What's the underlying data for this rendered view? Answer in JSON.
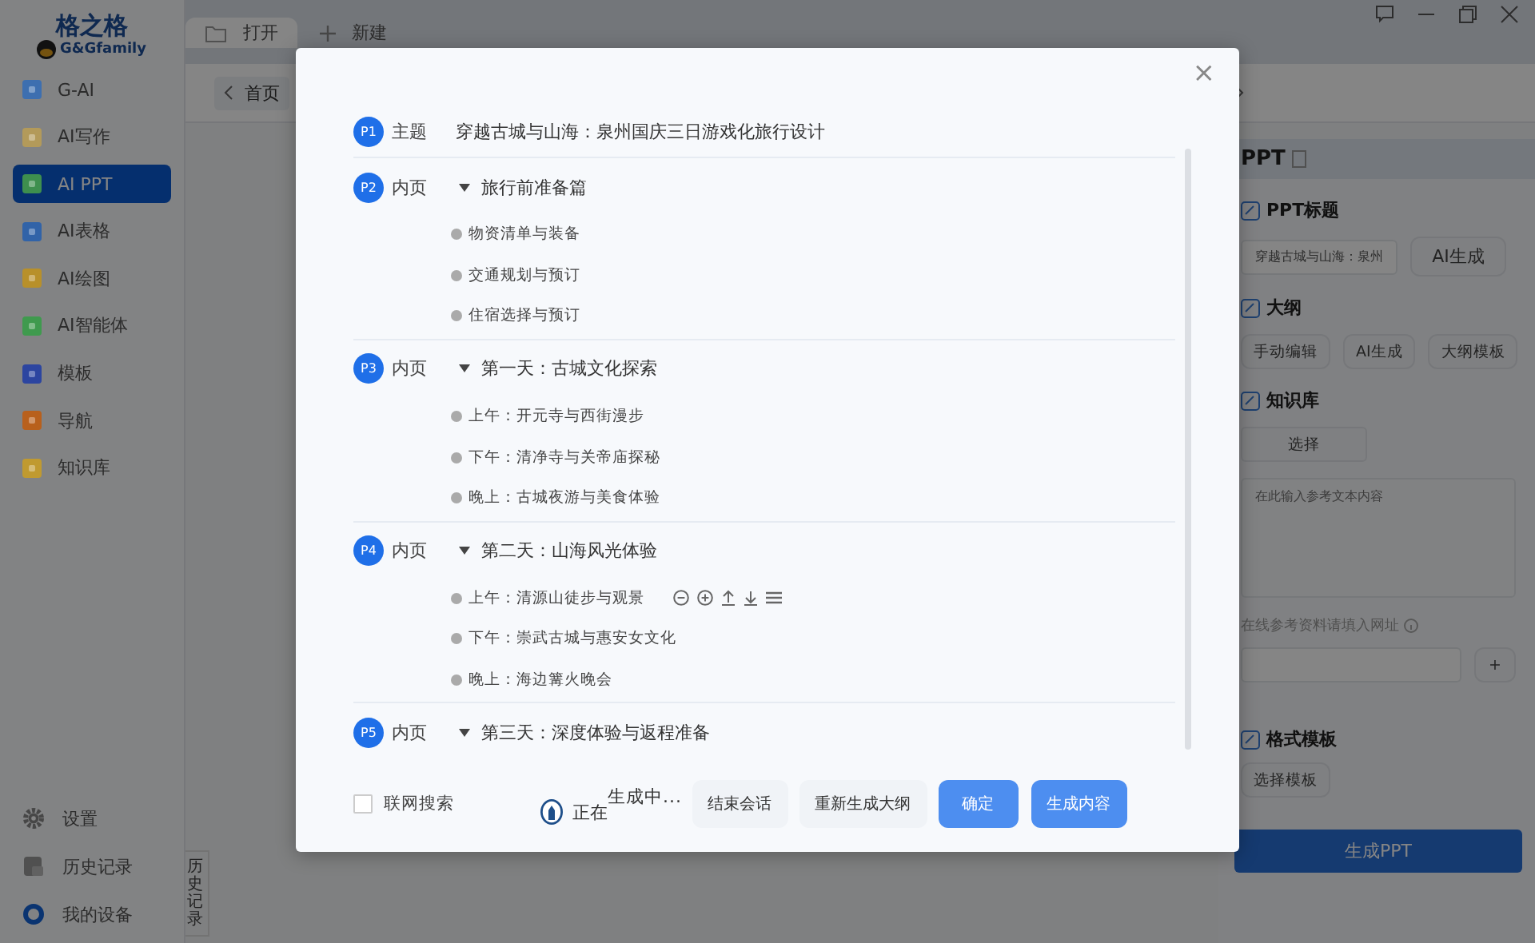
{
  "sidebar": {
    "logo": {
      "title": "格之格",
      "subtitle": "G&Gfamily"
    },
    "items": [
      {
        "label": "G-AI",
        "color": "#3d6fb0",
        "selected": false
      },
      {
        "label": "AI写作",
        "color": "#b39a5a",
        "selected": false
      },
      {
        "label": "AI PPT",
        "color": "#3e8f4e",
        "selected": true
      },
      {
        "label": "AI表格",
        "color": "#3163a8",
        "selected": false
      },
      {
        "label": "AI绘图",
        "color": "#b8902a",
        "selected": false
      },
      {
        "label": "AI智能体",
        "color": "#3f9a4e",
        "selected": false
      },
      {
        "label": "模板",
        "color": "#2c45a0",
        "selected": false
      },
      {
        "label": "导航",
        "color": "#b8601c",
        "selected": false
      },
      {
        "label": "知识库",
        "color": "#c09a30",
        "selected": false
      }
    ],
    "bottom": [
      {
        "label": "设置",
        "kind": "gear"
      },
      {
        "label": "历史记录",
        "kind": "history"
      },
      {
        "label": "我的设备",
        "kind": "device"
      }
    ]
  },
  "history_tab": "历史记录",
  "tabs": [
    {
      "label": "打开",
      "kind": "folder",
      "selected": true
    },
    {
      "label": "新建",
      "kind": "plus",
      "selected": false
    }
  ],
  "breadcrumb": "首页",
  "right_panel": {
    "title": "PPT",
    "ppt_title": {
      "label": "PPT标题",
      "value": "穿越古城与山海：泉州",
      "button": "AI生成"
    },
    "outline": {
      "label": "大纲",
      "buttons": [
        "手动编辑",
        "AI生成",
        "大纲模板"
      ]
    },
    "knowledge": {
      "label": "知识库",
      "button": "选择",
      "placeholder": "在此输入参考文本内容",
      "url_label": "在线参考资料请填入网址",
      "add": "+"
    },
    "format": {
      "label": "格式模板",
      "button": "选择模板"
    },
    "generate": "生成PPT"
  },
  "dialog": {
    "close": "×",
    "pages": [
      {
        "badge": "P1",
        "type": "主题",
        "title": "穿越古城与山海：泉州国庆三日游戏化旅行设计",
        "kind": "cover"
      },
      {
        "badge": "P2",
        "type": "内页",
        "title": "旅行前准备篇",
        "kind": "section",
        "expanded": true,
        "children": [
          {
            "text": "物资清单与装备",
            "actions": false
          },
          {
            "text": "交通规划与预订",
            "actions": false
          },
          {
            "text": "住宿选择与预订",
            "actions": false
          }
        ]
      },
      {
        "badge": "P3",
        "type": "内页",
        "title": "第一天：古城文化探索",
        "kind": "section",
        "expanded": true,
        "children": [
          {
            "text": "上午：开元寺与西街漫步",
            "actions": false
          },
          {
            "text": "下午：清净寺与关帝庙探秘",
            "actions": false
          },
          {
            "text": "晚上：古城夜游与美食体验",
            "actions": false
          }
        ]
      },
      {
        "badge": "P4",
        "type": "内页",
        "title": "第二天：山海风光体验",
        "kind": "section",
        "expanded": true,
        "children": [
          {
            "text": "上午：清源山徒步与观景",
            "actions": true
          },
          {
            "text": "下午：崇武古城与惠安女文化",
            "actions": false
          },
          {
            "text": "晚上：海边篝火晚会",
            "actions": false
          }
        ]
      },
      {
        "badge": "P5",
        "type": "内页",
        "title": "第三天：深度体验与返程准备",
        "kind": "section",
        "expanded": true
      }
    ],
    "footer": {
      "web_search": {
        "label": "联网搜索",
        "checked": false
      },
      "status": "正在",
      "status_raised": "生成中...",
      "buttons": [
        {
          "label": "结束会话",
          "kind": "plain"
        },
        {
          "label": "重新生成大纲",
          "kind": "plain"
        },
        {
          "label": "确定",
          "kind": "primary"
        },
        {
          "label": "生成内容",
          "kind": "primary"
        }
      ]
    }
  }
}
